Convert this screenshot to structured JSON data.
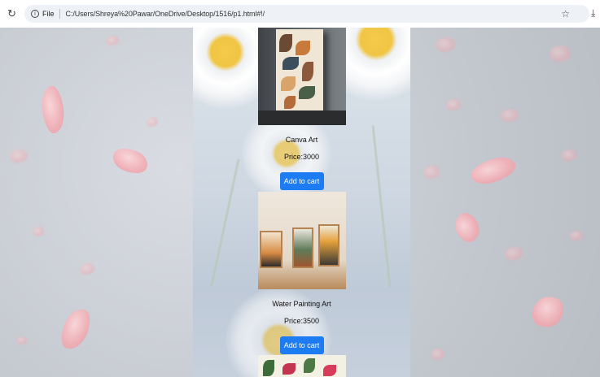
{
  "browser": {
    "file_label": "File",
    "url": "C:/Users/Shreya%20Pawar/OneDrive/Desktop/1516/p1.html#!/"
  },
  "icons": {
    "reload": "reload-icon",
    "info": "info-icon",
    "star": "star-icon",
    "download": "download-icon"
  },
  "colors": {
    "button": "#1e7cf2",
    "button_text": "#ffffff",
    "petal": "#f3a9b0"
  },
  "products": [
    {
      "name": "Canva Art",
      "price": "Price:3000",
      "button_label": "Add to cart"
    },
    {
      "name": "Water Painting Art",
      "price": "Price:3500",
      "button_label": "Add to cart"
    }
  ]
}
